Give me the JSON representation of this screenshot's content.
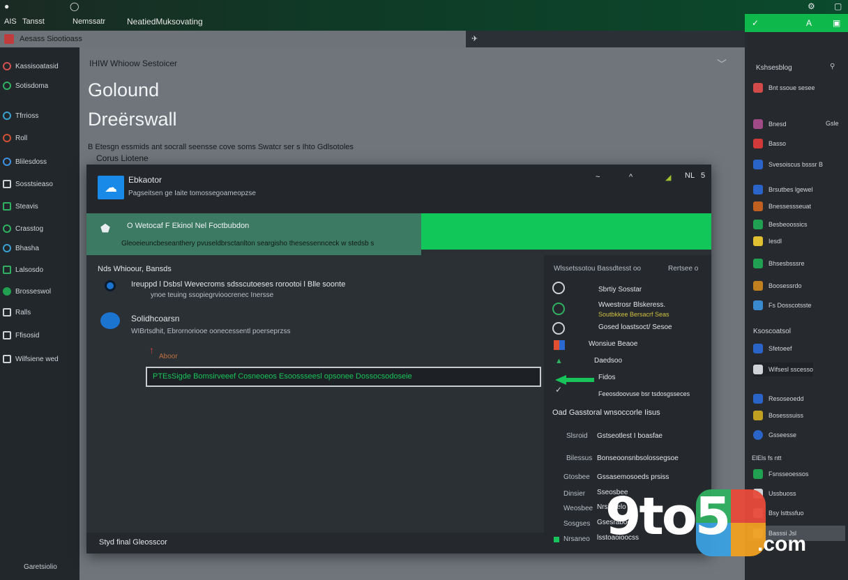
{
  "top": {
    "left_glyph": "AIS",
    "items": [
      "Tansst",
      "Nemssatr"
    ],
    "title": "NeatiedMuksovating",
    "green_letters": [
      "A"
    ]
  },
  "tab": {
    "label": "Aesass Siootioass"
  },
  "sidebar": {
    "items": [
      {
        "label": "Kassisoatasid"
      },
      {
        "label": "Sotisdoma"
      },
      {
        "label": "Tfrrioss"
      },
      {
        "label": "Roll"
      },
      {
        "label": "Blilesdoss"
      },
      {
        "label": "Sosstsieaso"
      },
      {
        "label": "Steavis"
      },
      {
        "label": "Crasstog"
      },
      {
        "label": "Bhasha"
      },
      {
        "label": "Lalsosdo"
      },
      {
        "label": "Brosseswol"
      },
      {
        "label": "Ralls"
      },
      {
        "label": "Ffisosid"
      },
      {
        "label": "Wilfsiene wed"
      }
    ],
    "bottom": "Garetsiolio"
  },
  "main": {
    "crumb": "IHIW Whioow Sestoicer",
    "heading1": "Golound",
    "heading2": "Dreërswall",
    "desc1": "B Etesgn essmids ant socrall seensse cove soms Swatcr ser s Ihto Gdlsotoles",
    "desc2": "Corus Liotene"
  },
  "dialog": {
    "title": "Ebkaotor",
    "subtitle": "Pagseitsen ge Iaite tomossegoameopzse",
    "header_icons": [
      "~",
      "^",
      "NL",
      "5"
    ],
    "banner_title": "O Wetocaf F Ekinol Nel Foctbubdon",
    "banner_desc": "Gleoeieuncbeseanthery pvuseldbrsctanlton seargisho thesessennceck w stedsb s",
    "section": "Nds Whioour, Bansds",
    "row1_title": "Ireuppd l Dsbsl Wevecroms sdsscutoeses rorootoi l Blle soonte",
    "row1_sub": "ynoe teuing ssopiegrvioocrenec Inersse",
    "row2_title": "Solidhcoarsn",
    "row2_sub": "WIBrtsdhit, Ebrornoriooe oonecessentl poerseprzss",
    "tag": "Aboor",
    "input_value": "PTEsSigde Bomsirveeef Cosneoeos Esoossseesl opsonee Dossocsodoseie",
    "footer": "Styd final Gleosscor"
  },
  "right_list": {
    "header": "Wlssetssotou Bassdtesst oo",
    "header_right": "Rertsee o",
    "items": [
      "Sbrtiy Sosstar",
      "Wwestrosr Blskeress.",
      "Soutbkkee Bersacrf Seas",
      "Gosed loastsoct/ Sesoe",
      "Wonsiue Beaoe",
      "Daedsoo",
      "Fidos",
      "Feeosdoovuse bsr tsdosgsseces"
    ],
    "section2": "Oad Gasstoral wnsoccorle Iisus",
    "items2": [
      {
        "left": "Slsroid",
        "right": "Gstseotlest I boasfae"
      },
      {
        "left": "Bilessus",
        "right": "Bonseoonsnbsolossegsoe"
      },
      {
        "left": "Gtosbee",
        "right": "Gssasemosoeds prsiss"
      },
      {
        "left": "Dinsier",
        "right": "Sseosbee"
      },
      {
        "left": "Weosbee",
        "right": "Nrsioselo"
      },
      {
        "left": "Sosgses",
        "right": "Gsesraboe"
      },
      {
        "left": "Nrsaneo",
        "right": "lsstoaoioocss"
      }
    ]
  },
  "right_panel": {
    "header": "Kshsesblog",
    "items": [
      {
        "label": "Bnt ssoue sesee",
        "color": "#d24a4a"
      },
      {
        "label": "Bnesd",
        "color": "#a04a88",
        "right": "Gsle"
      },
      {
        "label": "Basso",
        "color": "#d23a3a"
      },
      {
        "label": "Svesoiscus bsssr B",
        "color": "#2a64c8"
      },
      {
        "label": "Brsutbes lgewel",
        "color": "#2a64c8"
      },
      {
        "label": "Bnessessseuat",
        "color": "#c06020"
      },
      {
        "label": "Besbeoossics",
        "color": "#20a050"
      },
      {
        "label": "Iesdl",
        "color": "#e0c030"
      },
      {
        "label": "Bhsesbsssre",
        "color": "#20a050"
      },
      {
        "label": "Boosessrdo",
        "color": "#c08020"
      },
      {
        "label": "Fs Dosscotsste",
        "color": "#3a8ad0"
      }
    ],
    "section": "Ksoscoatsol",
    "items2": [
      {
        "label": "Sfetoeef",
        "color": "#2a64c8"
      },
      {
        "label": "Wifsesl sscesso",
        "color": "#d0d4d8"
      },
      {
        "label": "Resoseoedd",
        "color": "#2a64c8"
      },
      {
        "label": "Bosesssuiss",
        "color": "#c0a020"
      },
      {
        "label": "Gsseesse",
        "color": "#2a64c8"
      }
    ],
    "section2": "ElEls fs ntt",
    "items3": [
      {
        "label": "Fsnsseoessos",
        "color": "#20a050"
      },
      {
        "label": "Ussbuoss",
        "color": "#d0d4d8"
      },
      {
        "label": "Bsy lsttssfuo",
        "color": "#d0d4d8"
      },
      {
        "label": "Basssi Jsl",
        "color": "#d0d4d8"
      }
    ]
  },
  "watermark": {
    "digits": "9to5",
    "suffix": ".com"
  }
}
